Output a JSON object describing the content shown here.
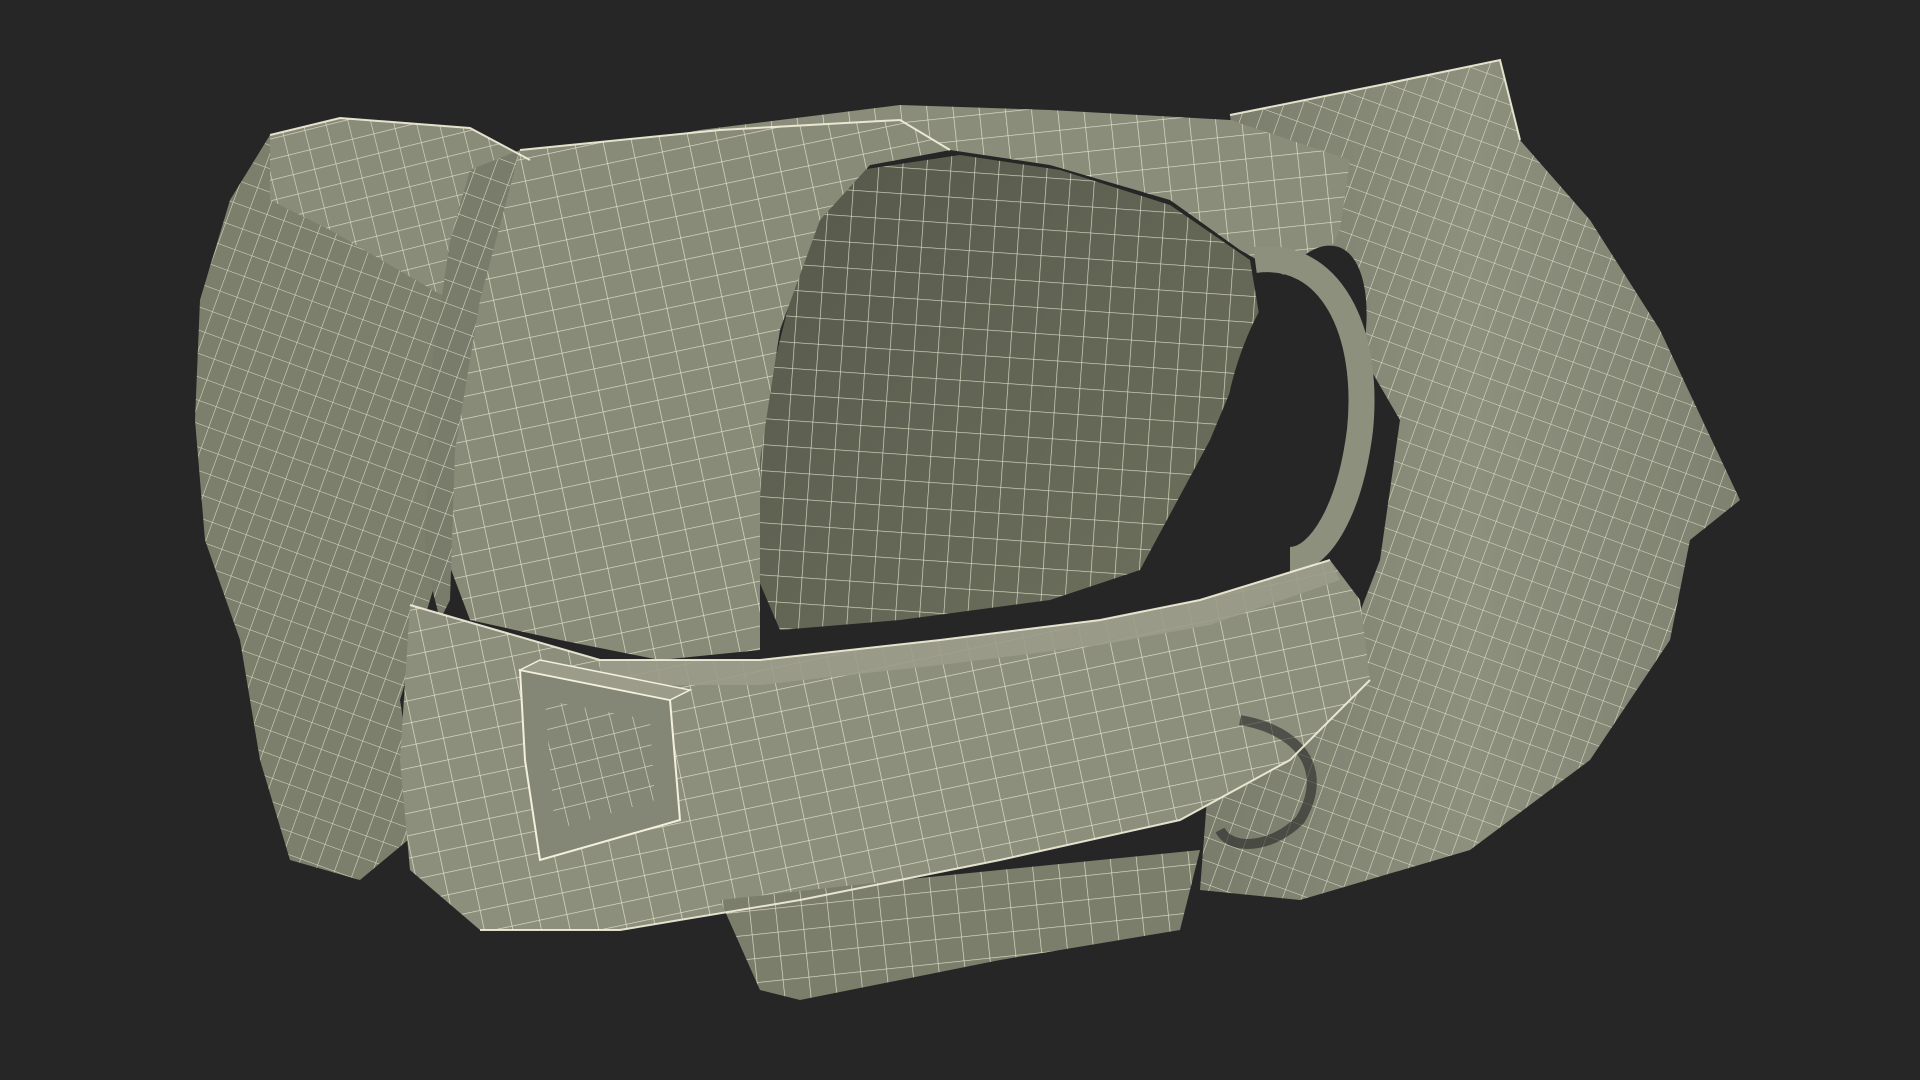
{
  "scene": {
    "subject": "vest-wireframe-render",
    "background_color": "#262626",
    "mesh_fill_color": "#8c8e7c",
    "mesh_shadow_color": "#6e705f",
    "mesh_inner_color": "#5c5e50",
    "wire_color": "#f3f1dc",
    "hole_color": "#262626"
  }
}
